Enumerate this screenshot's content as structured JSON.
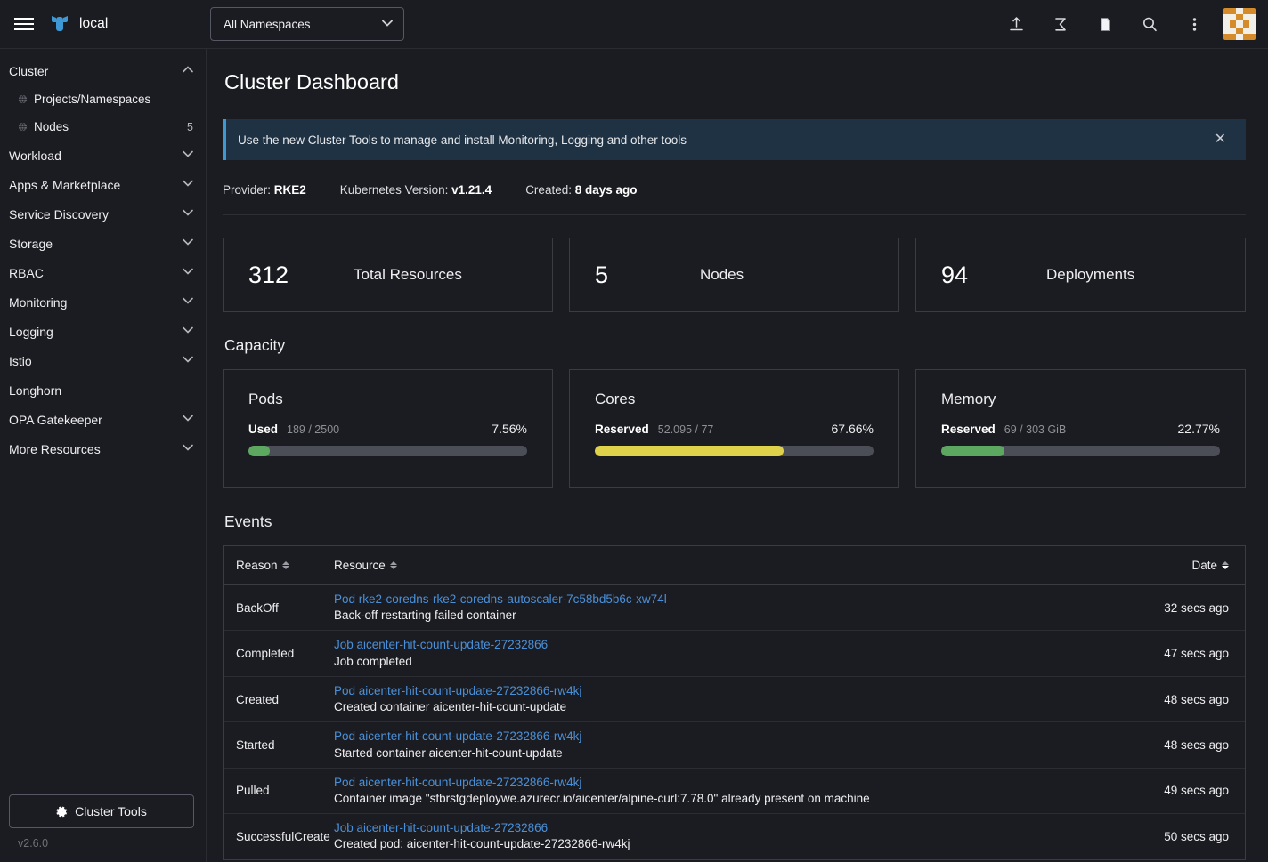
{
  "header": {
    "menu_icon": "hamburger-icon",
    "logo_icon": "rancher-cow-logo",
    "cluster_name": "local",
    "namespace_filter": {
      "value": "All Namespaces",
      "chevron": "⌄"
    },
    "icons": [
      {
        "name": "import-yaml-icon",
        "title": "Import YAML"
      },
      {
        "name": "kubectl-shell-icon",
        "title": "Kubectl Shell"
      },
      {
        "name": "docs-icon",
        "title": "Docs"
      },
      {
        "name": "search-icon",
        "title": "Search"
      },
      {
        "name": "kebab-menu-icon",
        "title": "More"
      }
    ],
    "avatar": {
      "name": "user-avatar",
      "color": "#d58b29"
    }
  },
  "sidebar": {
    "groups": [
      {
        "label": "Cluster",
        "expanded": true,
        "caret": "⌃",
        "children": [
          {
            "label": "Projects/Namespaces",
            "icon": "globe-icon",
            "count": ""
          },
          {
            "label": "Nodes",
            "icon": "globe-icon",
            "count": "5"
          }
        ]
      },
      {
        "label": "Workload",
        "expanded": false,
        "caret": "⌄",
        "children": []
      },
      {
        "label": "Apps & Marketplace",
        "expanded": false,
        "caret": "⌄",
        "children": []
      },
      {
        "label": "Service Discovery",
        "expanded": false,
        "caret": "⌄",
        "children": []
      },
      {
        "label": "Storage",
        "expanded": false,
        "caret": "⌄",
        "children": []
      },
      {
        "label": "RBAC",
        "expanded": false,
        "caret": "⌄",
        "children": []
      },
      {
        "label": "Monitoring",
        "expanded": false,
        "caret": "⌄",
        "children": []
      },
      {
        "label": "Logging",
        "expanded": false,
        "caret": "⌄",
        "children": []
      },
      {
        "label": "Istio",
        "expanded": false,
        "caret": "⌄",
        "children": []
      },
      {
        "label": "Longhorn",
        "expanded": false,
        "caret": "",
        "children": []
      },
      {
        "label": "OPA Gatekeeper",
        "expanded": false,
        "caret": "⌄",
        "children": []
      },
      {
        "label": "More Resources",
        "expanded": false,
        "caret": "⌄",
        "children": []
      }
    ],
    "cluster_tools_button": {
      "label": "Cluster Tools",
      "icon": "gear-icon"
    },
    "version": "v2.6.0"
  },
  "main": {
    "page_title": "Cluster Dashboard",
    "banner": {
      "text": "Use the new Cluster Tools to manage and install Monitoring, Logging and other tools",
      "close_icon": "close-icon",
      "accent_color": "#3d98d3",
      "background_color": "#1f3244"
    },
    "meta": [
      {
        "label": "Provider:",
        "value": "RKE2"
      },
      {
        "label": "Kubernetes Version:",
        "value": "v1.21.4"
      },
      {
        "label": "Created:",
        "value": "8 days ago"
      }
    ],
    "counts": [
      {
        "value": "312",
        "label": "Total Resources"
      },
      {
        "value": "5",
        "label": "Nodes"
      },
      {
        "value": "94",
        "label": "Deployments"
      }
    ],
    "capacity_title": "Capacity",
    "capacity": [
      {
        "title": "Pods",
        "state": "Used",
        "detail": "189 / 2500",
        "percent": "7.56%",
        "fill_pct": 7.56,
        "color": "#5ca861"
      },
      {
        "title": "Cores",
        "state": "Reserved",
        "detail": "52.095 / 77",
        "percent": "67.66%",
        "fill_pct": 67.66,
        "color": "#e0d14a"
      },
      {
        "title": "Memory",
        "state": "Reserved",
        "detail": "69 / 303 GiB",
        "percent": "22.77%",
        "fill_pct": 22.77,
        "color": "#5ca861"
      }
    ],
    "events_title": "Events",
    "events_columns": [
      {
        "label": "Reason",
        "sorted": false
      },
      {
        "label": "Resource",
        "sorted": false
      },
      {
        "label": "Date",
        "sorted": true,
        "direction": "desc"
      }
    ],
    "events": [
      {
        "reason": "BackOff",
        "resource": "Pod rke2-coredns-rke2-coredns-autoscaler-7c58bd5b6c-xw74l",
        "message": "Back-off restarting failed container",
        "date": "32 secs ago"
      },
      {
        "reason": "Completed",
        "resource": "Job aicenter-hit-count-update-27232866",
        "message": "Job completed",
        "date": "47 secs ago"
      },
      {
        "reason": "Created",
        "resource": "Pod aicenter-hit-count-update-27232866-rw4kj",
        "message": "Created container aicenter-hit-count-update",
        "date": "48 secs ago"
      },
      {
        "reason": "Started",
        "resource": "Pod aicenter-hit-count-update-27232866-rw4kj",
        "message": "Started container aicenter-hit-count-update",
        "date": "48 secs ago"
      },
      {
        "reason": "Pulled",
        "resource": "Pod aicenter-hit-count-update-27232866-rw4kj",
        "message": "Container image \"sfbrstgdeploywe.azurecr.io/aicenter/alpine-curl:7.78.0\" already present on machine",
        "date": "49 secs ago"
      },
      {
        "reason": "SuccessfulCreate",
        "resource": "Job aicenter-hit-count-update-27232866",
        "message": "Created pod: aicenter-hit-count-update-27232866-rw4kj",
        "date": "50 secs ago"
      }
    ]
  }
}
